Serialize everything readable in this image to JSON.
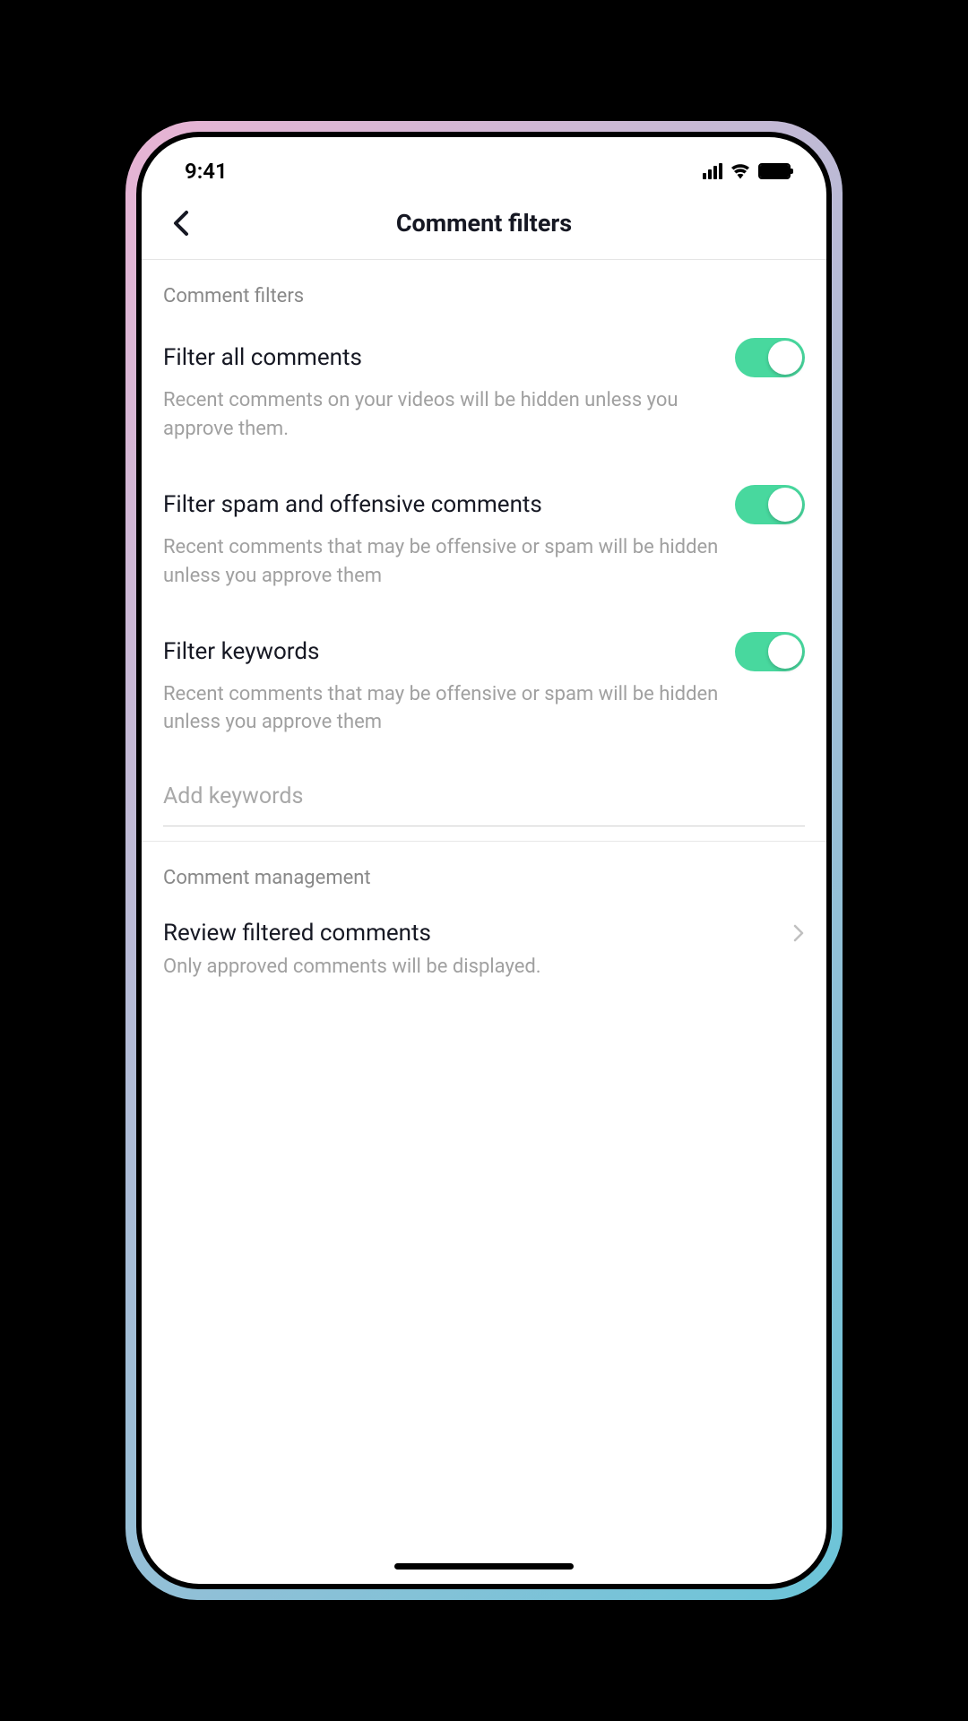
{
  "statusBar": {
    "time": "9:41"
  },
  "navBar": {
    "title": "Comment filters"
  },
  "sections": {
    "filters": {
      "label": "Comment filters",
      "items": [
        {
          "title": "Filter all comments",
          "description": "Recent comments on your videos will be hidden unless you approve them.",
          "enabled": true
        },
        {
          "title": "Filter spam and offensive comments",
          "description": "Recent comments that may be offensive or spam will be hidden unless you approve them",
          "enabled": true
        },
        {
          "title": "Filter keywords",
          "description": "Recent comments that may be offensive or spam will be hidden unless you approve them",
          "enabled": true
        }
      ],
      "keywordInput": {
        "placeholder": "Add keywords",
        "value": ""
      }
    },
    "management": {
      "label": "Comment management",
      "items": [
        {
          "title": "Review filtered comments",
          "description": "Only approved comments will be displayed."
        }
      ]
    }
  }
}
